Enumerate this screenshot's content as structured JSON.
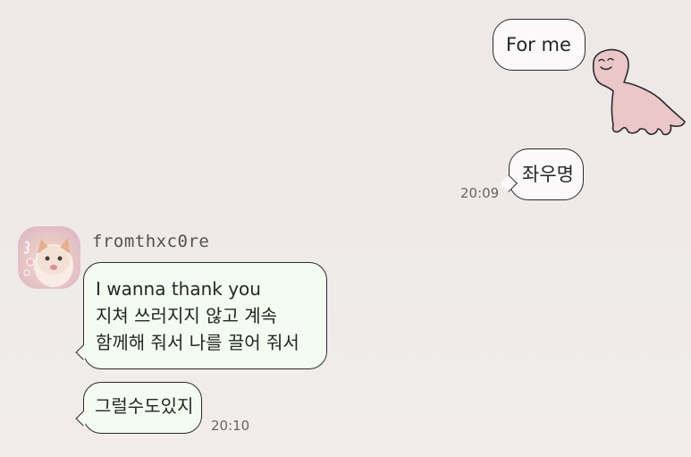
{
  "conversation": {
    "outgoing": [
      {
        "text": "For me"
      },
      {
        "text": "좌우명",
        "time": "20:09"
      }
    ],
    "incoming": {
      "sender": "fromthxc0re",
      "avatar_icon": "kitten-photo-avatar",
      "messages": [
        {
          "lines": [
            "I wanna thank you",
            "지쳐 쓰러지지 않고 계속",
            "함께해 줘서 나를 끌어 줘서"
          ]
        },
        {
          "lines": [
            "그럴수도있지"
          ],
          "time": "20:10"
        }
      ]
    }
  },
  "theme": {
    "background": "#efe9e9",
    "outgoing_bubble": "#fbf9f9",
    "incoming_bubble": "#f4fcf2",
    "border": "#2b2b2b",
    "sticker_color": "#ebc7ca"
  },
  "sticker": {
    "icon": "pink-dinosaur-icon"
  }
}
